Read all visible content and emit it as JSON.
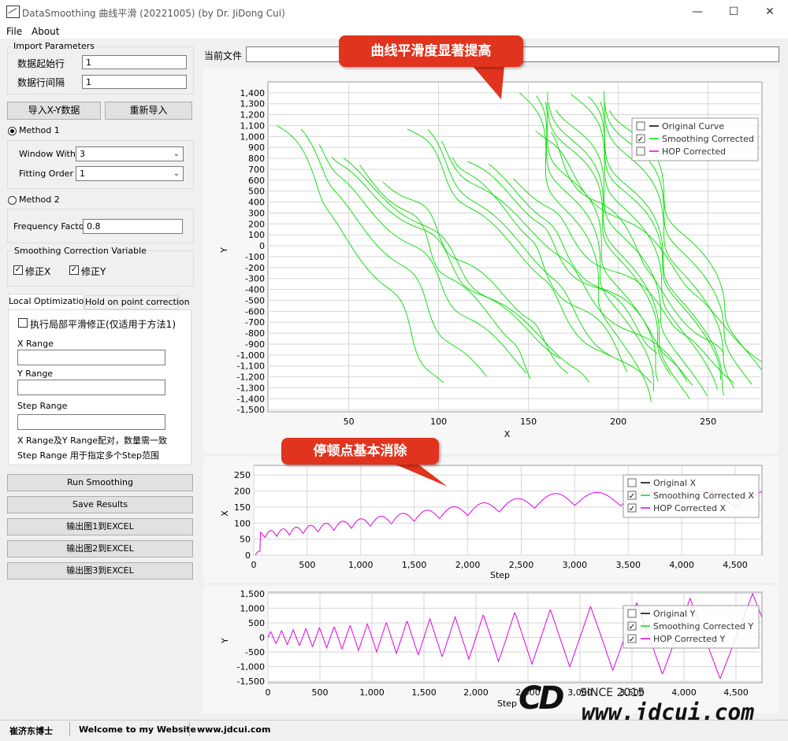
{
  "window": {
    "title": "DataSmoothing 曲线平滑 (20221005) (by Dr. JiDong Cui)",
    "minimize": "—",
    "maximize": "☐",
    "close": "✕"
  },
  "menu": {
    "file": "File",
    "about": "About"
  },
  "import": {
    "group_title": "Import Parameters",
    "start_row_label": "数据起始行",
    "start_row_value": "1",
    "row_interval_label": "数据行间隔",
    "row_interval_value": "1"
  },
  "buttons": {
    "import_xy": "导入X-Y数据",
    "reimport": "重新导入",
    "run": "Run Smoothing",
    "save": "Save Results",
    "export1": "输出图1到EXCEL",
    "export2": "输出图2到EXCEL",
    "export3": "输出图3到EXCEL"
  },
  "method1": {
    "label": "Method 1",
    "window_label": "Window With",
    "window_value": "3",
    "order_label": "Fitting Order",
    "order_value": "1"
  },
  "method2": {
    "label": "Method 2",
    "freq_label": "Frequency Factor",
    "freq_value": "0.8"
  },
  "correction": {
    "group_title": "Smoothing Correction Variable",
    "fix_x": "修正X",
    "fix_y": "修正Y"
  },
  "tabs": {
    "local": "Local Optimization",
    "hold": "Hold on point correction"
  },
  "local": {
    "exec_label": "执行局部平滑修正(仅适用于方法1)",
    "x_range": "X Range",
    "y_range": "Y Range",
    "step_range": "Step Range",
    "note1": "X Range及Y Range配对，数量需一致",
    "note2": "Step Range 用于指定多个Step范围"
  },
  "file": {
    "label": "当前文件",
    "value": ""
  },
  "callouts": {
    "top": "曲线平滑度显著提高",
    "mid": "停顿点基本消除"
  },
  "status": {
    "author": "崔济东博士",
    "welcome": "Welcome to my Website",
    "site": "www.jdcui.com"
  },
  "watermark": {
    "since": "SINCE 2015",
    "logo": "CD",
    "url": "www.jdcui.com"
  },
  "colors": {
    "green": "#00dd00",
    "magenta": "#e000e0",
    "callout": "#e0341e"
  },
  "chart_data": [
    {
      "type": "line",
      "xlabel": "X",
      "ylabel": "Y",
      "xlim": [
        5,
        280
      ],
      "ylim": [
        -1520,
        1500
      ],
      "xticks": [
        "50",
        "100",
        "150",
        "200",
        "250"
      ],
      "yticks": [
        "1,400",
        "1,300",
        "1,200",
        "1,100",
        "1,000",
        "900",
        "800",
        "700",
        "600",
        "500",
        "400",
        "300",
        "200",
        "100",
        "0",
        "-100",
        "-200",
        "-300",
        "-400",
        "-500",
        "-600",
        "-700",
        "-800",
        "-900",
        "-1,000",
        "-1,100",
        "-1,200",
        "-1,300",
        "-1,400",
        "-1,500"
      ],
      "legend": [
        {
          "name": "Original Curve",
          "checked": false,
          "color": "#000000"
        },
        {
          "name": "Smoothing Corrected",
          "checked": true,
          "color": "#00dd00"
        },
        {
          "name": "HOP Corrected",
          "checked": false,
          "color": "#e000e0"
        }
      ],
      "legend_position": "top-right"
    },
    {
      "type": "line",
      "xlabel": "Step",
      "ylabel": "X",
      "xlim": [
        0,
        4750
      ],
      "ylim": [
        0,
        280
      ],
      "xticks": [
        "0",
        "500",
        "1,000",
        "1,500",
        "2,000",
        "2,500",
        "3,000",
        "3,500",
        "4,000",
        "4,500"
      ],
      "yticks": [
        "250",
        "200",
        "150",
        "100",
        "50",
        "0"
      ],
      "legend": [
        {
          "name": "Original X",
          "checked": false,
          "color": "#000000"
        },
        {
          "name": "Smoothing Corrected X",
          "checked": true,
          "color": "#00dd00"
        },
        {
          "name": "HOP Corrected X",
          "checked": true,
          "color": "#e000e0"
        }
      ],
      "legend_position": "top-right"
    },
    {
      "type": "line",
      "xlabel": "Step",
      "ylabel": "Y",
      "xlim": [
        0,
        4750
      ],
      "ylim": [
        -1550,
        1550
      ],
      "xticks": [
        "0",
        "500",
        "1,000",
        "1,500",
        "2,000",
        "2,500",
        "3,000",
        "3,500",
        "4,000",
        "4,500"
      ],
      "yticks": [
        "1,500",
        "1,000",
        "500",
        "0",
        "-500",
        "-1,000",
        "-1,500"
      ],
      "legend": [
        {
          "name": "Original Y",
          "checked": false,
          "color": "#000000"
        },
        {
          "name": "Smoothing Corrected Y",
          "checked": true,
          "color": "#00dd00"
        },
        {
          "name": "HOP Corrected Y",
          "checked": true,
          "color": "#e000e0"
        }
      ],
      "legend_position": "top-right"
    }
  ]
}
